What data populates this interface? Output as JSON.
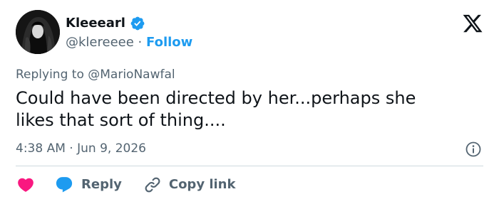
{
  "author": {
    "display_name": "Kleeearl",
    "handle": "@klereeee",
    "separator": "·",
    "follow_label": "Follow",
    "verified": true
  },
  "reply_context": {
    "prefix": "Replying to",
    "target": "@MarioNawfal"
  },
  "tweet": {
    "line1": "Could have been directed by her...perhaps she",
    "line2": "likes that sort of thing...."
  },
  "timestamp": {
    "time": "4:38 AM",
    "separator": "·",
    "date": "Jun 9, 2026"
  },
  "actions": {
    "reply_label": "Reply",
    "copy_link_label": "Copy link"
  },
  "icons": {
    "logo": "x-logo-icon",
    "verified": "verified-badge-icon",
    "info": "info-icon",
    "like": "heart-icon",
    "reply": "speech-bubble-icon",
    "copy_link": "link-icon"
  },
  "colors": {
    "accent": "#1d9bf0",
    "like": "#f91880",
    "text": "#0f1419",
    "muted": "#536471",
    "divider": "#cfd9de"
  }
}
